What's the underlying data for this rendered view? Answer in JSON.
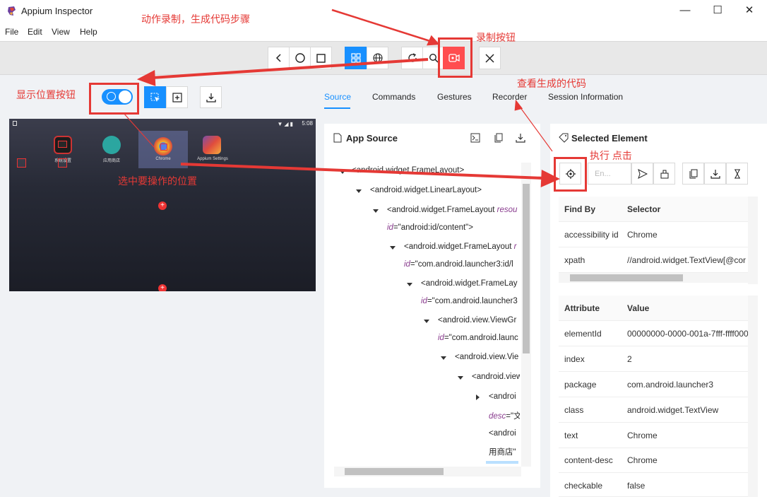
{
  "window": {
    "title": "Appium Inspector",
    "controls": [
      "—",
      "☐",
      "✕"
    ]
  },
  "menu": [
    "File",
    "Edit",
    "View",
    "Help"
  ],
  "icons": {
    "back": "chevron-left-icon",
    "home": "circle-icon",
    "square": "square-icon",
    "native_mode": "grid-icon",
    "web_mode": "globe-icon",
    "refresh": "refresh-icon",
    "search": "search-icon",
    "record": "record-icon",
    "quit": "close-icon"
  },
  "tabs": [
    {
      "label": "Source",
      "active": true
    },
    {
      "label": "Commands"
    },
    {
      "label": "Gestures"
    },
    {
      "label": "Recorder"
    },
    {
      "label": "Session Information"
    }
  ],
  "device": {
    "time": "5:08",
    "apps": [
      "系统设置",
      "应用商店",
      "Chrome",
      "Appium Settings"
    ]
  },
  "source_panel": {
    "title": "App Source",
    "lines": [
      {
        "text": "<android.widget.FrameLayout>"
      },
      {
        "text": "<android.widget.LinearLayout>"
      },
      {
        "text": "<android.widget.FrameLayout ",
        "attr": "resou"
      },
      {
        "attr": "id",
        "value": "=\"android:id/content\">"
      },
      {
        "text": "<android.widget.FrameLayout ",
        "attr": "r"
      },
      {
        "attr": "id",
        "value": "=\"com.android.launcher3:id/l"
      },
      {
        "text": "<android.widget.FrameLay"
      },
      {
        "attr": "id",
        "value": "=\"com.android.launcher3"
      },
      {
        "text": "<android.view.ViewGr"
      },
      {
        "attr": "id",
        "value": "=\"com.android.launc"
      },
      {
        "text": "<android.view.Vie"
      },
      {
        "text": "<android.view"
      },
      {
        "text": "<androi"
      },
      {
        "attr": "desc",
        "value": "=\"文"
      },
      {
        "text": "<androi"
      },
      {
        "text": "用商店\""
      }
    ]
  },
  "selected_element": {
    "title": "Selected Element",
    "find_placeholder": "En...",
    "find_by_header": [
      "Find By",
      "Selector"
    ],
    "find_by": [
      [
        "accessibility id",
        "Chrome"
      ],
      [
        "xpath",
        "//android.widget.TextView[@cor"
      ]
    ],
    "attr_header": [
      "Attribute",
      "Value"
    ],
    "attributes": [
      [
        "elementId",
        "00000000-0000-001a-7fff-ffff000"
      ],
      [
        "index",
        "2"
      ],
      [
        "package",
        "com.android.launcher3"
      ],
      [
        "class",
        "android.widget.TextView"
      ],
      [
        "text",
        "Chrome"
      ],
      [
        "content-desc",
        "Chrome"
      ],
      [
        "checkable",
        "false"
      ]
    ]
  },
  "annotations": {
    "record_steps": "动作录制，生成代码步骤",
    "record_button": "录制按钮",
    "view_code": "查看生成的代码",
    "show_position": "显示位置按钮",
    "tap": "执行 点击",
    "select_position": "选中要操作的位置"
  },
  "colors": {
    "accent": "#1890ff",
    "annotation": "#e53935",
    "record": "#ff4d4f"
  }
}
